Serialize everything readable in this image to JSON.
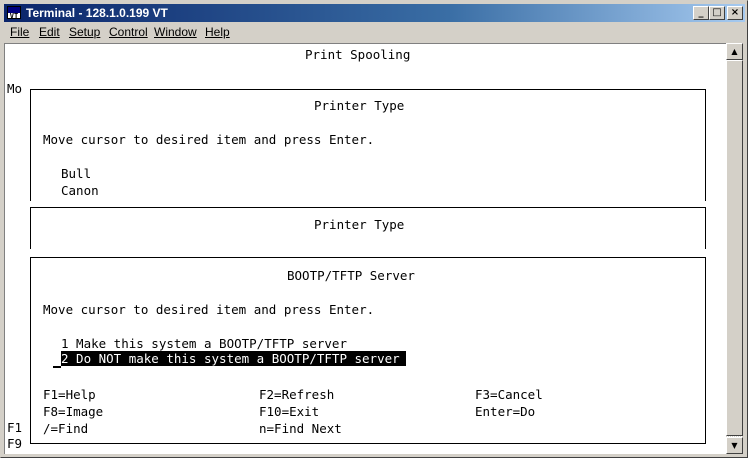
{
  "window": {
    "title": "Terminal - 128.1.0.199 VT",
    "app_icon": "VT",
    "controls": [
      "_",
      "□",
      "×"
    ]
  },
  "menu": [
    "File",
    "Edit",
    "Setup",
    "Control",
    "Window",
    "Help"
  ],
  "screen": {
    "header": "Print Spooling",
    "left_margin": [
      "Mo",
      "F1",
      "F9"
    ],
    "dialog1": {
      "title": "Printer Type",
      "instruction": "Move cursor to desired item and press Enter.",
      "items": [
        "Bull",
        "Canon"
      ]
    },
    "dialog2": {
      "title": "Printer Type"
    },
    "dialog3": {
      "title": "BOOTP/TFTP Server",
      "instruction": "Move cursor to desired item and press Enter.",
      "options": [
        "1 Make this system a BOOTP/TFTP server",
        "2 Do NOT make this system a BOOTP/TFTP server"
      ],
      "selected_index": 1,
      "function_keys": [
        [
          "F1=Help",
          "F2=Refresh",
          "F3=Cancel"
        ],
        [
          "F8=Image",
          "F10=Exit",
          "Enter=Do"
        ],
        [
          "/=Find",
          "n=Find Next",
          ""
        ]
      ]
    }
  },
  "colors": {
    "titlebar": "#0a246a",
    "terminal_bg": "#ffffff",
    "terminal_fg": "#000000"
  }
}
